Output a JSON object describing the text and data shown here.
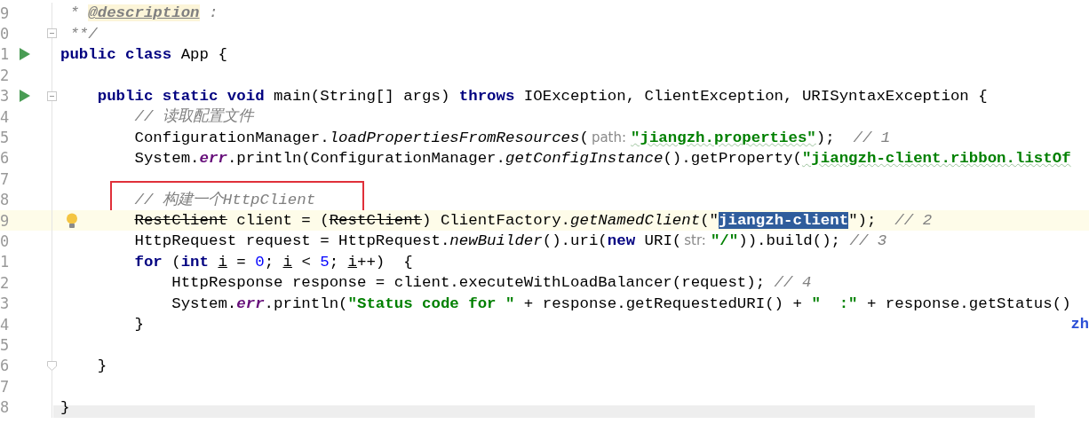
{
  "lines": [
    {
      "number": "9",
      "current": false,
      "boxed": false,
      "run": false,
      "bulb": false,
      "fold_start": false,
      "fold_end": false,
      "tokens": [
        {
          "kind": "comment",
          "text": " * "
        },
        {
          "kind": "doctag",
          "text": "@description"
        },
        {
          "kind": "comment",
          "text": " :"
        }
      ]
    },
    {
      "number": "0",
      "current": false,
      "boxed": false,
      "run": false,
      "bulb": false,
      "fold_start": true,
      "fold_end": false,
      "tokens": [
        {
          "kind": "comment",
          "text": " **/"
        }
      ]
    },
    {
      "number": "1",
      "current": false,
      "boxed": false,
      "run": true,
      "bulb": false,
      "fold_start": false,
      "fold_end": false,
      "tokens": [
        {
          "kind": "keyword",
          "text": "public class"
        },
        {
          "kind": "plain",
          "text": " App {"
        }
      ]
    },
    {
      "number": "2",
      "current": false,
      "boxed": false,
      "run": false,
      "bulb": false,
      "fold_start": false,
      "fold_end": false
    },
    {
      "number": "3",
      "current": false,
      "boxed": false,
      "run": true,
      "bulb": false,
      "fold_start": true,
      "fold_end": false,
      "tokens": [
        {
          "kind": "keyword",
          "text": "    public static void"
        },
        {
          "kind": "plain",
          "text": " main(String[] args) "
        },
        {
          "kind": "keyword",
          "text": "throws"
        },
        {
          "kind": "plain",
          "text": " IOException, ClientException, URISyntaxException {"
        }
      ]
    },
    {
      "number": "4",
      "current": false,
      "boxed": false,
      "run": false,
      "bulb": false,
      "fold_start": false,
      "fold_end": false,
      "tokens": [
        {
          "kind": "comment",
          "text": "        // 读取配置文件"
        }
      ]
    },
    {
      "number": "5",
      "current": false,
      "boxed": false,
      "run": false,
      "bulb": false,
      "fold_start": false,
      "fold_end": false,
      "tokens": [
        {
          "kind": "plain",
          "text": "        ConfigurationManager."
        },
        {
          "kind": "static",
          "text": "loadPropertiesFromResources"
        },
        {
          "kind": "plain",
          "text": "("
        },
        {
          "kind": "hint",
          "text": "path:"
        },
        {
          "kind": "typo_string",
          "text": "\"jiangzh.properties\""
        },
        {
          "kind": "plain",
          "text": ");  "
        },
        {
          "kind": "comment",
          "text": "// 1"
        }
      ]
    },
    {
      "number": "6",
      "current": false,
      "boxed": false,
      "run": false,
      "bulb": false,
      "fold_start": false,
      "fold_end": false,
      "tokens": [
        {
          "kind": "plain",
          "text": "        System."
        },
        {
          "kind": "field",
          "text": "err"
        },
        {
          "kind": "plain",
          "text": ".println(ConfigurationManager."
        },
        {
          "kind": "static",
          "text": "getConfigInstance"
        },
        {
          "kind": "plain",
          "text": "().getProperty("
        },
        {
          "kind": "typo_string",
          "text": "\"jiangzh-client.ribbon.listOf"
        }
      ]
    },
    {
      "number": "7",
      "current": false,
      "boxed": false,
      "run": false,
      "bulb": false,
      "fold_start": false,
      "fold_end": false
    },
    {
      "number": "8",
      "current": false,
      "boxed": true,
      "run": false,
      "bulb": false,
      "fold_start": false,
      "fold_end": false,
      "tokens": [
        {
          "kind": "comment",
          "text": "        // 构建一个HttpClient"
        }
      ]
    },
    {
      "number": "9",
      "current": true,
      "boxed": false,
      "run": false,
      "bulb": true,
      "fold_start": false,
      "fold_end": false,
      "tokens": [
        {
          "kind": "deprecated",
          "text": "        RestClient"
        },
        {
          "kind": "plain",
          "text": " client = ("
        },
        {
          "kind": "deprecated",
          "text": "RestClient"
        },
        {
          "kind": "plain",
          "text": ") ClientFactory."
        },
        {
          "kind": "static",
          "text": "getNamedClient"
        },
        {
          "kind": "plain",
          "text": "(\""
        },
        {
          "kind": "selection",
          "text": "jiangzh-client"
        },
        {
          "kind": "plain",
          "text": "\");  "
        },
        {
          "kind": "comment",
          "text": "// 2"
        }
      ]
    },
    {
      "number": "0",
      "current": false,
      "boxed": false,
      "run": false,
      "bulb": false,
      "fold_start": false,
      "fold_end": false,
      "tokens": [
        {
          "kind": "plain",
          "text": "        HttpRequest request = HttpRequest."
        },
        {
          "kind": "static",
          "text": "newBuilder"
        },
        {
          "kind": "plain",
          "text": "().uri("
        },
        {
          "kind": "keyword",
          "text": "new"
        },
        {
          "kind": "plain",
          "text": " URI("
        },
        {
          "kind": "hint",
          "text": "str:"
        },
        {
          "kind": "string",
          "text": "\"/\""
        },
        {
          "kind": "plain",
          "text": ")).build(); "
        },
        {
          "kind": "comment",
          "text": "// 3"
        }
      ]
    },
    {
      "number": "1",
      "current": false,
      "boxed": false,
      "run": false,
      "bulb": false,
      "fold_start": false,
      "fold_end": false,
      "tokens": [
        {
          "kind": "keyword",
          "text": "        for"
        },
        {
          "kind": "plain",
          "text": " ("
        },
        {
          "kind": "keyword",
          "text": "int "
        },
        {
          "kind": "reassigned",
          "text": "i"
        },
        {
          "kind": "plain",
          "text": " = "
        },
        {
          "kind": "number",
          "text": "0"
        },
        {
          "kind": "plain",
          "text": "; "
        },
        {
          "kind": "reassigned",
          "text": "i"
        },
        {
          "kind": "plain",
          "text": " < "
        },
        {
          "kind": "number",
          "text": "5"
        },
        {
          "kind": "plain",
          "text": "; "
        },
        {
          "kind": "reassigned",
          "text": "i"
        },
        {
          "kind": "plain",
          "text": "++)  {"
        }
      ]
    },
    {
      "number": "2",
      "current": false,
      "boxed": false,
      "run": false,
      "bulb": false,
      "fold_start": false,
      "fold_end": false,
      "tokens": [
        {
          "kind": "plain",
          "text": "            HttpResponse response = client.executeWithLoadBalancer(request); "
        },
        {
          "kind": "comment",
          "text": "// 4"
        }
      ]
    },
    {
      "number": "3",
      "current": false,
      "boxed": false,
      "run": false,
      "bulb": false,
      "fold_start": false,
      "fold_end": false,
      "tokens": [
        {
          "kind": "plain",
          "text": "            System."
        },
        {
          "kind": "field",
          "text": "err"
        },
        {
          "kind": "plain",
          "text": ".println("
        },
        {
          "kind": "string",
          "text": "\"Status code for \""
        },
        {
          "kind": "plain",
          "text": " + response.getRequestedURI() + "
        },
        {
          "kind": "string",
          "text": "\"  :\""
        },
        {
          "kind": "plain",
          "text": " + response.getStatus()"
        }
      ]
    },
    {
      "number": "4",
      "current": false,
      "boxed": false,
      "run": false,
      "bulb": false,
      "fold_start": false,
      "fold_end": false,
      "right_text": "zh",
      "tokens": [
        {
          "kind": "plain",
          "text": "        }"
        }
      ]
    },
    {
      "number": "5",
      "current": false,
      "boxed": false,
      "run": false,
      "bulb": false,
      "fold_start": false,
      "fold_end": false
    },
    {
      "number": "6",
      "current": false,
      "boxed": false,
      "run": false,
      "bulb": false,
      "fold_start": false,
      "fold_end": true,
      "tokens": [
        {
          "kind": "plain",
          "text": "    }"
        }
      ]
    },
    {
      "number": "7",
      "current": false,
      "boxed": false,
      "run": false,
      "bulb": false,
      "fold_start": false,
      "fold_end": false
    },
    {
      "number": "8",
      "current": false,
      "boxed": false,
      "run": false,
      "bulb": false,
      "fold_start": false,
      "fold_end": false,
      "tokens": [
        {
          "kind": "plain",
          "text": "}"
        }
      ]
    }
  ]
}
